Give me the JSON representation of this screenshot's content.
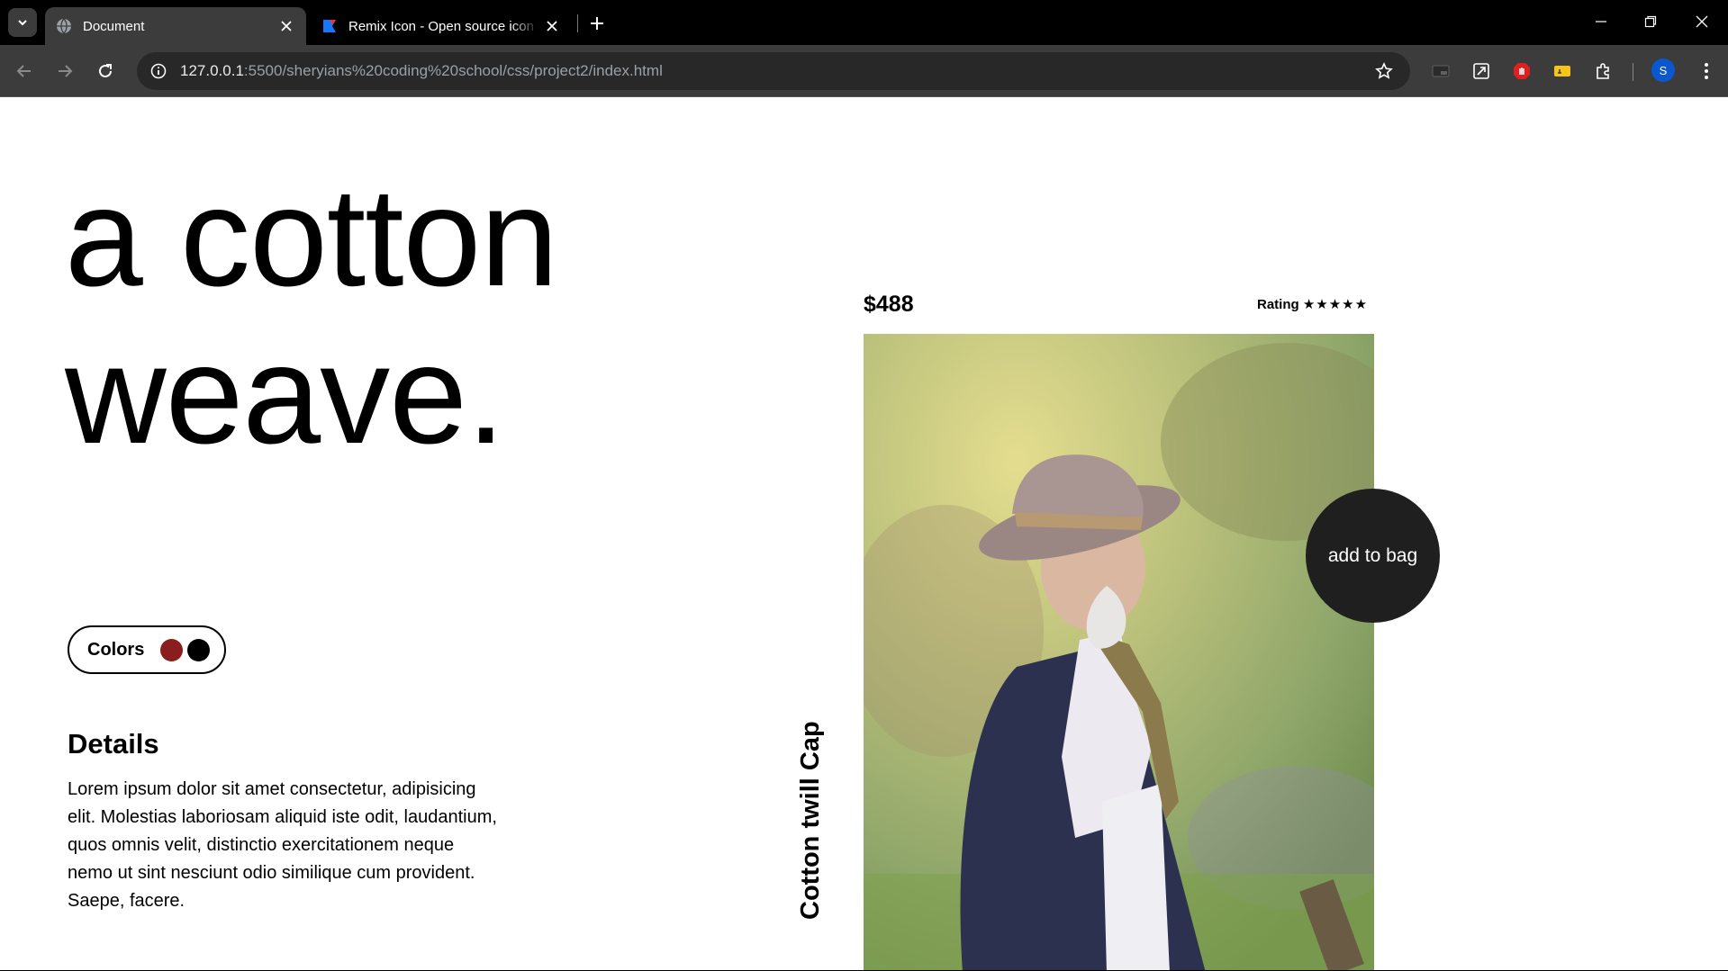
{
  "browser": {
    "tabs": [
      {
        "title": "Document",
        "active": true,
        "icon": "globe-icon"
      },
      {
        "title": "Remix Icon - Open source icon library",
        "active": false,
        "icon": "remix-logo-icon"
      }
    ],
    "url_host": "127.0.0.1",
    "url_path": ":5500/sheryians%20coding%20school/css/project2/index.html",
    "profile_initial": "S",
    "colors": {
      "chrome_bg": "#000000",
      "toolbar_bg": "#3c3c3c",
      "omnibox_bg": "#282828",
      "avatar": "#0b57d0"
    }
  },
  "hero": {
    "line1": "a cotton",
    "line2": "weave."
  },
  "colors_picker": {
    "label": "Colors",
    "swatches": [
      "#8a1e1e",
      "#000000"
    ]
  },
  "details": {
    "title": "Details",
    "text": "Lorem ipsum dolor sit amet consectetur, adipisicing elit. Molestias laboriosam aliquid iste odit, laudantium, quos omnis velit, distinctio exercitationem neque nemo ut sint nesciunt odio similique cum provident. Saepe, facere."
  },
  "product": {
    "price": "$488",
    "rating_label": "Rating",
    "stars": "★★★★★",
    "rating_value": 5,
    "name": "Cotton twill Cap",
    "add_to_bag_label": "add to bag",
    "image_subject": "elderly man wearing a felt hat and vest in an orchard"
  }
}
